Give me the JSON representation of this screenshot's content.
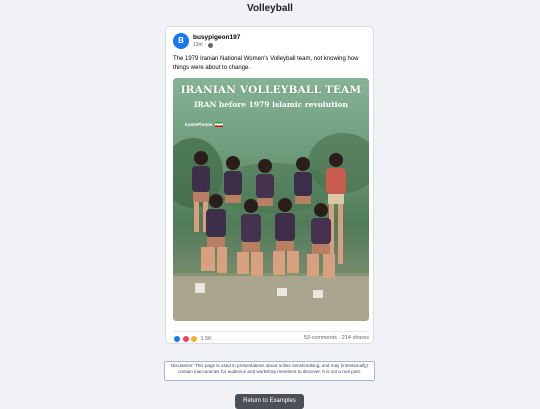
{
  "page": {
    "title": "Volleyball"
  },
  "post": {
    "avatar_letter": "B",
    "username": "busypigeon197",
    "time": "13m",
    "text": "The 1979 Iranian National Women's Volleyball team, not knowing how things were about to change.",
    "photo": {
      "headline": "IRANIAN VOLLEYBALL TEAM",
      "subhead": "IRAN before 1979 islamic revolution",
      "watermark": "IranInPhotos"
    },
    "reactions": {
      "icons": [
        "like-icon",
        "love-icon",
        "wow-icon"
      ],
      "count": "1.5K"
    },
    "engagement": "53 comments · 214 shares"
  },
  "disclaimer": "Disclaimer: This page is used in presentations about online sensemaking, and may (intentionally) contain inaccuracies for audience and workshop members to discover. It is not a real post.",
  "return_button": "Return to Examples",
  "colors": {
    "accent": "#1877f2",
    "button": "#4b4f56",
    "background": "#f0f2f5"
  }
}
